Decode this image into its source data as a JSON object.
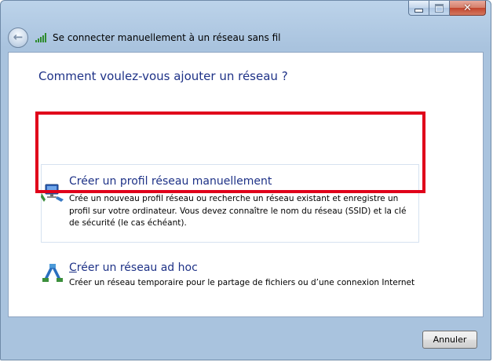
{
  "window": {
    "title": "Se connecter manuellement à un réseau sans fil",
    "controls": {
      "minimize_icon": "minimize-icon",
      "maximize_icon": "maximize-icon",
      "close_icon": "close-icon"
    }
  },
  "nav": {
    "back_icon": "back-arrow-icon",
    "wifi_icon": "wireless-signal-icon",
    "title": "Se connecter manuellement à un réseau sans fil"
  },
  "content": {
    "heading": "Comment voulez-vous ajouter un réseau ?",
    "options": [
      {
        "icon": "network-computer-icon",
        "title": "Créer un profil réseau manuellement",
        "description": "Crée un nouveau profil réseau ou recherche un réseau existant et enregistre un profil sur votre ordinateur. Vous devez connaître le nom du réseau (SSID) et la clé de sécurité (le cas échéant)."
      },
      {
        "icon": "adhoc-network-icon",
        "title_first_letter": "C",
        "title_rest": "réer un réseau ad hoc",
        "description": "Créer un réseau temporaire pour le partage de fichiers ou d’une connexion Internet"
      }
    ]
  },
  "footer": {
    "cancel_label": "Annuler"
  },
  "colors": {
    "heading": "#1e3287",
    "highlight_box": "#e0001a",
    "window_frame": "#a9c3de"
  }
}
